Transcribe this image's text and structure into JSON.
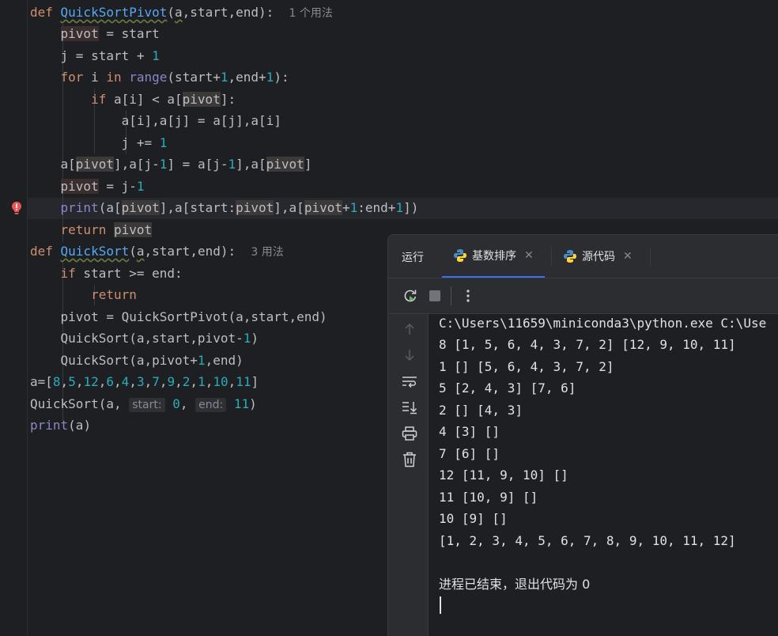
{
  "editor": {
    "code_lines": [
      "def QuickSortPivot(a,start,end):",
      "    pivot = start",
      "    j = start + 1",
      "    for i in range(start+1,end+1):",
      "        if a[i] < a[pivot]:",
      "            a[i],a[j] = a[j],a[i]",
      "            j += 1",
      "    a[pivot],a[j-1] = a[j-1],a[pivot]",
      "    pivot = j-1",
      "    print(a[pivot],a[start:pivot],a[pivot+1:end+1])",
      "    return pivot",
      "def QuickSort(a,start,end):",
      "    if start >= end:",
      "        return",
      "    pivot = QuickSortPivot(a,start,end)",
      "    QuickSort(a,start,pivot-1)",
      "    QuickSort(a,pivot+1,end)",
      "a=[8,5,12,6,4,3,7,9,2,1,10,11]",
      "QuickSort(a, start: 0, end: 11)",
      "print(a)"
    ],
    "usage_hint_1": "1 个用法",
    "usage_hint_2": "3 用法",
    "inlay_start": "start:",
    "inlay_end": "end:"
  },
  "run_panel": {
    "title": "运行",
    "tabs": [
      {
        "label": "基数排序",
        "active": true
      },
      {
        "label": "源代码",
        "active": false
      }
    ],
    "console_lines": [
      "C:\\Users\\11659\\miniconda3\\python.exe C:\\Use",
      "8 [1, 5, 6, 4, 3, 7, 2] [12, 9, 10, 11]",
      "1 [] [5, 6, 4, 3, 7, 2]",
      "5 [2, 4, 3] [7, 6]",
      "2 [] [4, 3]",
      "4 [3] []",
      "7 [6] []",
      "12 [11, 9, 10] []",
      "11 [10, 9] []",
      "10 [9] []",
      "[1, 2, 3, 4, 5, 6, 7, 8, 9, 10, 11, 12]",
      "",
      "进程已结束，退出代码为 0"
    ]
  },
  "colors": {
    "background": "#1e1f22",
    "keyword": "#cf8e6d",
    "function": "#56a8f5",
    "number": "#2aacb8",
    "builtin": "#8888c6",
    "accent": "#3574f0",
    "error": "#e55757"
  }
}
